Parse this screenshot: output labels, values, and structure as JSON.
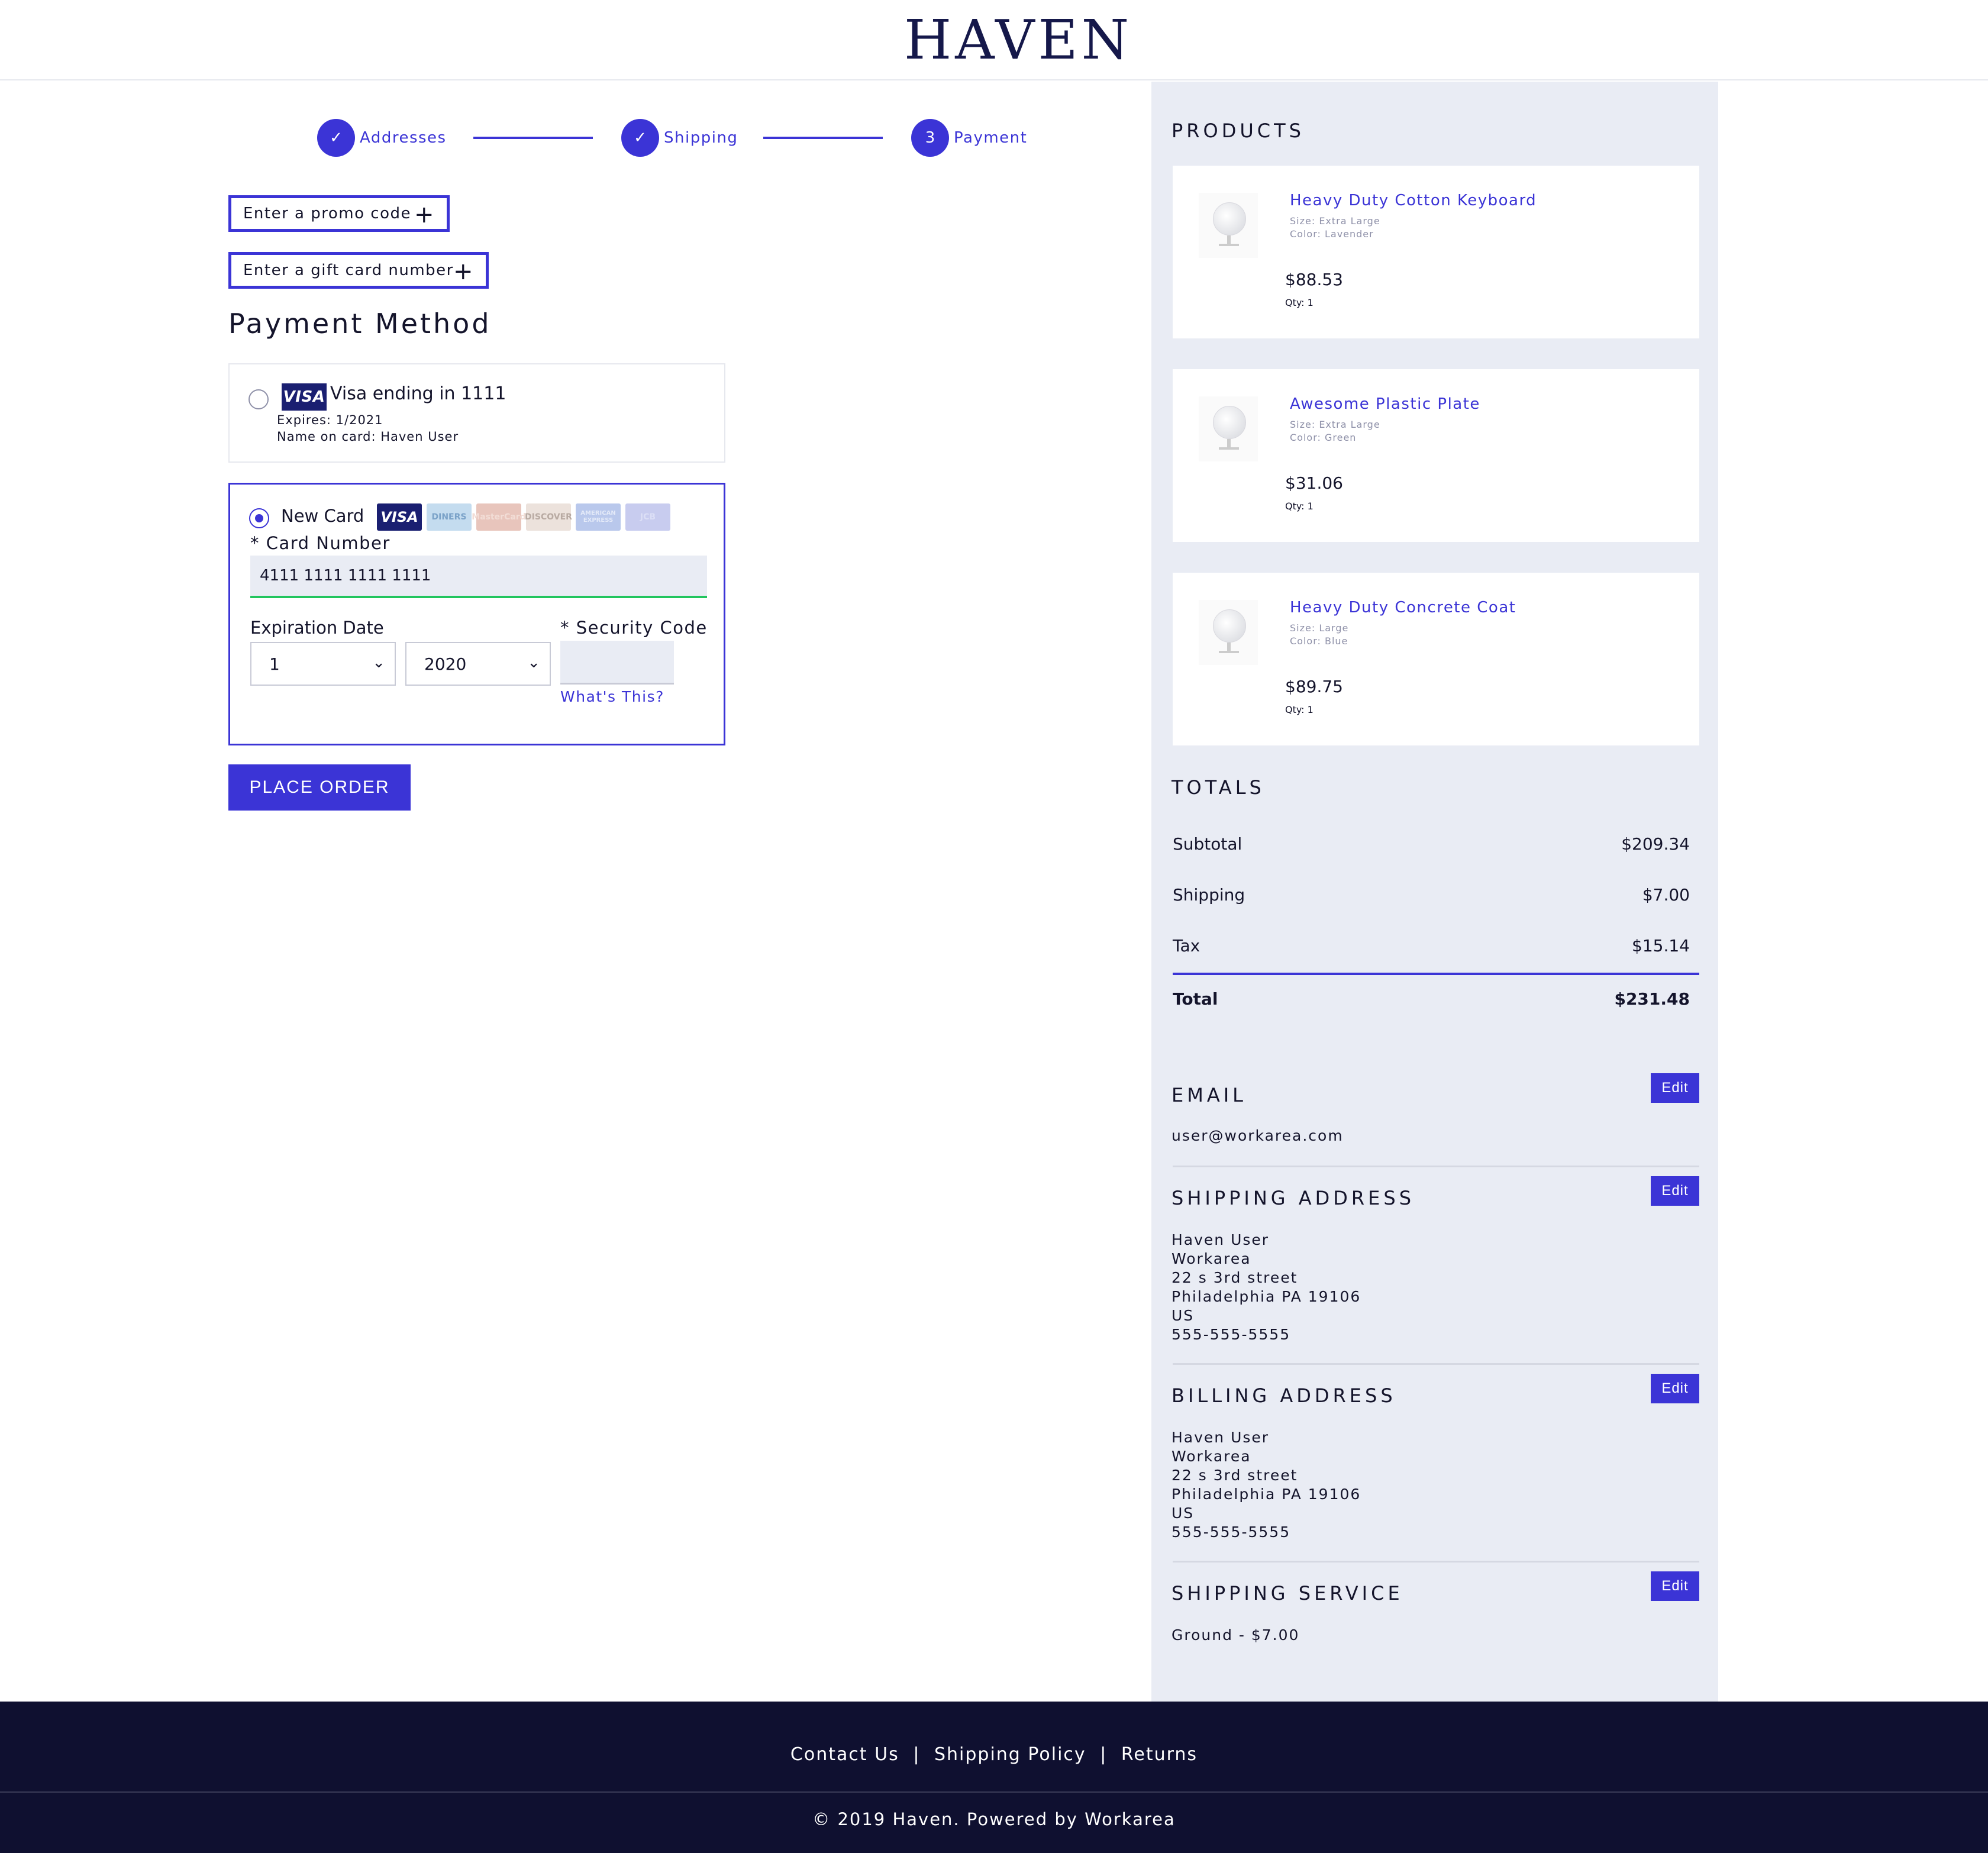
{
  "header": {
    "logo": "HAVEN"
  },
  "stepper": {
    "steps": [
      {
        "label": "Addresses",
        "marker": "✓"
      },
      {
        "label": "Shipping",
        "marker": "✓"
      },
      {
        "label": "Payment",
        "marker": "3"
      }
    ]
  },
  "promo": {
    "label": "Enter a promo code",
    "icon": "+"
  },
  "gift": {
    "label": "Enter a gift card number",
    "icon": "+"
  },
  "payment": {
    "title": "Payment Method",
    "saved_card": {
      "brand": "VISA",
      "title": "Visa ending in 1111",
      "expires": "Expires: 1/2021",
      "name": "Name on card: Haven User"
    },
    "new_card": {
      "label": "New Card",
      "logos": [
        "VISA",
        "DINERS",
        "MasterCard",
        "DISCOVER",
        "AMERICAN EXPRESS",
        "JCB"
      ],
      "card_number_label": "* Card Number",
      "card_number_value": "4111 1111 1111 1111",
      "expiration_label": "Expiration Date",
      "month_value": "1",
      "year_value": "2020",
      "security_label": "* Security Code",
      "whats_this": "What's This?"
    },
    "place_order": "PLACE ORDER"
  },
  "sidebar": {
    "products_heading": "PRODUCTS",
    "products": [
      {
        "name": "Heavy Duty Cotton Keyboard",
        "size": "Size: Extra Large",
        "color": "Color: Lavender",
        "price": "$88.53",
        "qty": "Qty: 1"
      },
      {
        "name": "Awesome Plastic Plate",
        "size": "Size: Extra Large",
        "color": "Color: Green",
        "price": "$31.06",
        "qty": "Qty: 1"
      },
      {
        "name": "Heavy Duty Concrete Coat",
        "size": "Size: Large",
        "color": "Color: Blue",
        "price": "$89.75",
        "qty": "Qty: 1"
      }
    ],
    "totals_heading": "TOTALS",
    "totals": {
      "subtotal_label": "Subtotal",
      "subtotal": "$209.34",
      "shipping_label": "Shipping",
      "shipping": "$7.00",
      "tax_label": "Tax",
      "tax": "$15.14",
      "total_label": "Total",
      "total": "$231.48"
    },
    "edit_label": "Edit",
    "email": {
      "heading": "EMAIL",
      "value": "user@workarea.com"
    },
    "shipping_address": {
      "heading": "SHIPPING ADDRESS",
      "lines": [
        "Haven User",
        "Workarea",
        "22 s 3rd street",
        "Philadelphia PA 19106",
        "US",
        "555-555-5555"
      ]
    },
    "billing_address": {
      "heading": "BILLING ADDRESS",
      "lines": [
        "Haven User",
        "Workarea",
        "22 s 3rd street",
        "Philadelphia PA 19106",
        "US",
        "555-555-5555"
      ]
    },
    "shipping_service": {
      "heading": "SHIPPING SERVICE",
      "value": "Ground - $7.00"
    }
  },
  "footer": {
    "links": [
      "Contact Us",
      "Shipping Policy",
      "Returns"
    ],
    "separator": "|",
    "copyright": "© 2019 Haven. Powered by Workarea"
  },
  "colors": {
    "accent": "#3b34d6",
    "sidebar_bg": "#e9ecf4",
    "footer_bg": "#0f1030",
    "success": "#22c55e"
  }
}
